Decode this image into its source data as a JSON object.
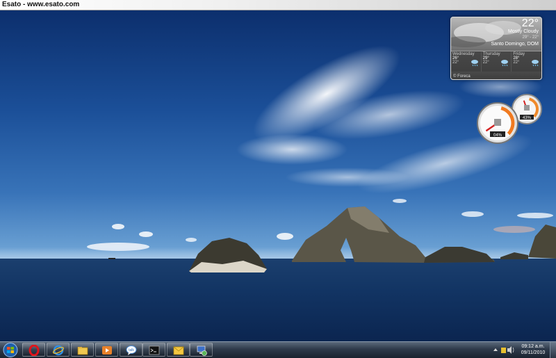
{
  "banner": {
    "title": "Esato - www.esato.com"
  },
  "weather": {
    "current_temp": "22°",
    "condition": "Mostly Cloudy",
    "range": "29° - 22°",
    "location": "Santo Domingo, DOM",
    "forecast": [
      {
        "day": "Wednesday",
        "high": "26°",
        "low": "22°",
        "icon": "rain-cloud-icon"
      },
      {
        "day": "Thursday",
        "high": "29°",
        "low": "22°",
        "icon": "rain-cloud-icon"
      },
      {
        "day": "Friday",
        "high": "28°",
        "low": "22°",
        "icon": "rain-cloud-icon"
      }
    ],
    "provider": "© Foreca"
  },
  "meters": {
    "cpu_percent": "04%",
    "cpu_value": 4,
    "memory_percent": "43%",
    "memory_value": 43
  },
  "taskbar": {
    "apps": [
      {
        "name": "opera",
        "icon": "opera-icon"
      },
      {
        "name": "internet-explorer",
        "icon": "ie-icon"
      },
      {
        "name": "explorer",
        "icon": "folder-icon"
      },
      {
        "name": "media-player",
        "icon": "media-player-icon"
      },
      {
        "name": "gtalk",
        "icon": "talk-icon",
        "label": "talk"
      },
      {
        "name": "cmd",
        "icon": "console-icon"
      },
      {
        "name": "outlook",
        "icon": "mail-icon"
      },
      {
        "name": "connection",
        "icon": "network-app-icon"
      }
    ],
    "clock": {
      "time": "09:12 a.m.",
      "date": "09/11/2010"
    }
  }
}
